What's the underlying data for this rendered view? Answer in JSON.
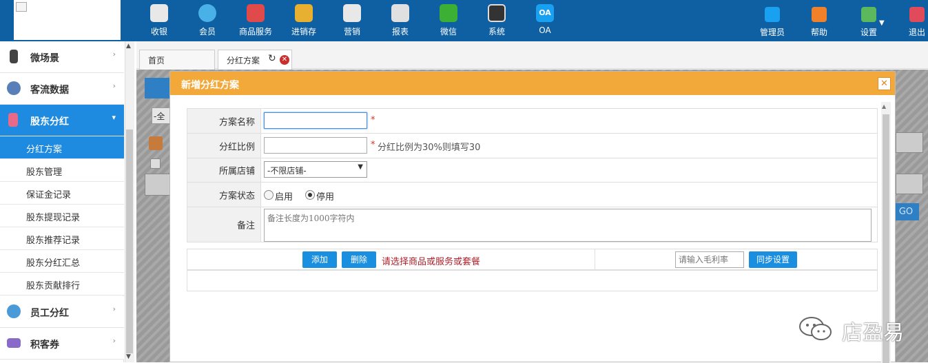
{
  "topnav": [
    {
      "label": "收银",
      "icon": "cashier-icon",
      "color": "#e8e8e8"
    },
    {
      "label": "会员",
      "icon": "member-icon",
      "color": "#4ab0e8"
    },
    {
      "label": "商品服务",
      "icon": "product-icon",
      "color": "#e04a4a"
    },
    {
      "label": "进销存",
      "icon": "inventory-icon",
      "color": "#e8b030"
    },
    {
      "label": "营销",
      "icon": "megaphone-icon",
      "color": "#e8e8e8"
    },
    {
      "label": "报表",
      "icon": "report-icon",
      "color": "#e8e8e8"
    },
    {
      "label": "微信",
      "icon": "wechat-icon",
      "color": "#3cb034"
    },
    {
      "label": "系统",
      "icon": "monitor-icon",
      "color": "#333333"
    },
    {
      "label": "OA",
      "icon": "oa-icon",
      "color": "#1aa0f0"
    }
  ],
  "topright": [
    {
      "label": "管理员",
      "icon": "admin-icon",
      "color": "#1aa0f0"
    },
    {
      "label": "帮助",
      "icon": "help-icon",
      "color": "#f0802a"
    },
    {
      "label": "设置",
      "icon": "settings-icon",
      "color": "#5cb85c"
    },
    {
      "label": "退出",
      "icon": "logout-icon",
      "color": "#e04a5a"
    }
  ],
  "sidebar": {
    "menus": [
      {
        "label": "微场景",
        "icon": "phone-icon",
        "color": "#444444"
      },
      {
        "label": "客流数据",
        "icon": "eye-icon",
        "color": "#5a7fb8"
      },
      {
        "label": "股东分红",
        "icon": "document-icon",
        "color": "#e86a8a"
      },
      {
        "label": "员工分红",
        "icon": "person-icon",
        "color": "#4a9ad8"
      },
      {
        "label": "积客券",
        "icon": "coupon-icon",
        "color": "#8a6ac8"
      }
    ],
    "submenu": [
      "分红方案",
      "股东管理",
      "保证金记录",
      "股东提现记录",
      "股东推荐记录",
      "股东分红汇总",
      "股东贡献排行"
    ]
  },
  "tabs": {
    "home": "首页",
    "active": "分红方案"
  },
  "background": {
    "select_text": "-全",
    "go_label": "GO"
  },
  "modal": {
    "title": "新増分红方案",
    "fields": {
      "name_label": "方案名称",
      "ratio_label": "分红比例",
      "ratio_hint": "分红比例为30%则填写30",
      "store_label": "所属店铺",
      "store_value": "-不限店铺-",
      "status_label": "方案状态",
      "status_enable": "启用",
      "status_disable": "停用",
      "status_selected": "停用",
      "remark_label": "备注",
      "remark_placeholder": "备注长度为1000字符内",
      "required_mark": "*"
    },
    "actions": {
      "add": "添加",
      "delete": "删除",
      "warning": "请选择商品或服务或套餐",
      "margin_placeholder": "请输入毛利率",
      "sync": "同步设置"
    }
  },
  "watermark": "店盈易"
}
